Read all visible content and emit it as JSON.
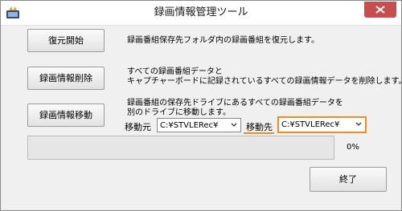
{
  "window": {
    "title": "録画情報管理ツール"
  },
  "buttons": {
    "restore": "復元開始",
    "delete": "録画情報削除",
    "move": "録画情報移動",
    "close": "終了"
  },
  "descriptions": {
    "restore": "録画番組保存先フォルダ内の録画番組を復元します。",
    "delete_line1": "すべての録画番組データと",
    "delete_line2": "キャプチャーボードに記録されているすべての録画情報データを削除します。",
    "move_line1": "録画番組の保存先ドライブにあるすべての録画番組データを",
    "move_line2": "別のドライブに移動します。"
  },
  "move": {
    "source_label": "移動元",
    "source_value": "C:¥STVLERec¥",
    "dest_label": "移動先",
    "dest_value": "C:¥STVLERec¥"
  },
  "progress": {
    "percent_text": "0%",
    "value": 0
  },
  "colors": {
    "highlight": "#f08c22",
    "close_button": "#c74e4e"
  },
  "icons": {
    "app": "app-icon",
    "close": "close-icon",
    "dropdown": "chevron-down-icon"
  }
}
